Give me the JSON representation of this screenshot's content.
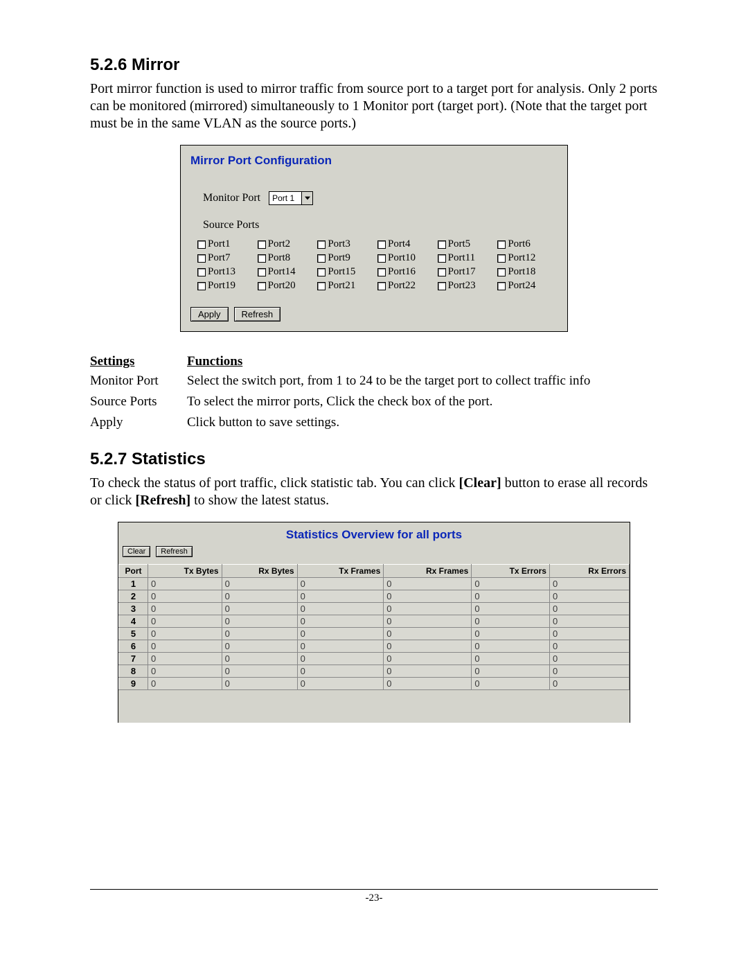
{
  "mirror": {
    "heading": "5.2.6  Mirror",
    "paragraph": "Port mirror function is used to mirror traffic from source port to a target port for analysis. Only 2 ports can be monitored (mirrored) simultaneously to 1 Monitor port (target port). (Note that the target port must be in the same VLAN as the source ports.)",
    "panel": {
      "title": "Mirror Port Configuration",
      "monitor_label": "Monitor Port",
      "monitor_value": "Port 1",
      "source_label": "Source Ports",
      "ports": [
        "Port1",
        "Port2",
        "Port3",
        "Port4",
        "Port5",
        "Port6",
        "Port7",
        "Port8",
        "Port9",
        "Port10",
        "Port11",
        "Port12",
        "Port13",
        "Port14",
        "Port15",
        "Port16",
        "Port17",
        "Port18",
        "Port19",
        "Port20",
        "Port21",
        "Port22",
        "Port23",
        "Port24"
      ],
      "ports_checked": [
        false,
        false,
        false,
        false,
        false,
        false,
        false,
        false,
        false,
        false,
        false,
        false,
        false,
        false,
        false,
        false,
        false,
        false,
        false,
        false,
        false,
        false,
        false,
        false
      ],
      "apply_label": "Apply",
      "refresh_label": "Refresh"
    },
    "settings_header": {
      "left": "Settings",
      "right": "Functions"
    },
    "settings_rows": [
      {
        "k": "Monitor Port",
        "v": "Select the switch port, from 1 to 24 to be the target port to collect traffic info"
      },
      {
        "k": "Source  Ports",
        "v": "To select the mirror ports, Click the check box of the port."
      },
      {
        "k": "Apply",
        "v": "Click button to save settings."
      }
    ]
  },
  "stats": {
    "heading": "5.2.7  Statistics",
    "paragraph_parts": [
      "To check the status of port traffic, click statistic tab. You can click ",
      "[Clear]",
      " button to erase all records or click ",
      "[Refresh]",
      " to show the latest status."
    ],
    "panel": {
      "title": "Statistics Overview for all ports",
      "clear_label": "Clear",
      "refresh_label": "Refresh",
      "headers": [
        "Port",
        "Tx Bytes",
        "Rx Bytes",
        "Tx Frames",
        "Rx Frames",
        "Tx Errors",
        "Rx Errors"
      ]
    }
  },
  "chart_data": {
    "type": "table",
    "title": "Statistics Overview for all ports",
    "columns": [
      "Port",
      "Tx Bytes",
      "Rx Bytes",
      "Tx Frames",
      "Rx Frames",
      "Tx Errors",
      "Rx Errors"
    ],
    "rows": [
      [
        1,
        0,
        0,
        0,
        0,
        0,
        0
      ],
      [
        2,
        0,
        0,
        0,
        0,
        0,
        0
      ],
      [
        3,
        0,
        0,
        0,
        0,
        0,
        0
      ],
      [
        4,
        0,
        0,
        0,
        0,
        0,
        0
      ],
      [
        5,
        0,
        0,
        0,
        0,
        0,
        0
      ],
      [
        6,
        0,
        0,
        0,
        0,
        0,
        0
      ],
      [
        7,
        0,
        0,
        0,
        0,
        0,
        0
      ],
      [
        8,
        0,
        0,
        0,
        0,
        0,
        0
      ],
      [
        9,
        0,
        0,
        0,
        0,
        0,
        0
      ]
    ]
  },
  "page_number": "-23-"
}
